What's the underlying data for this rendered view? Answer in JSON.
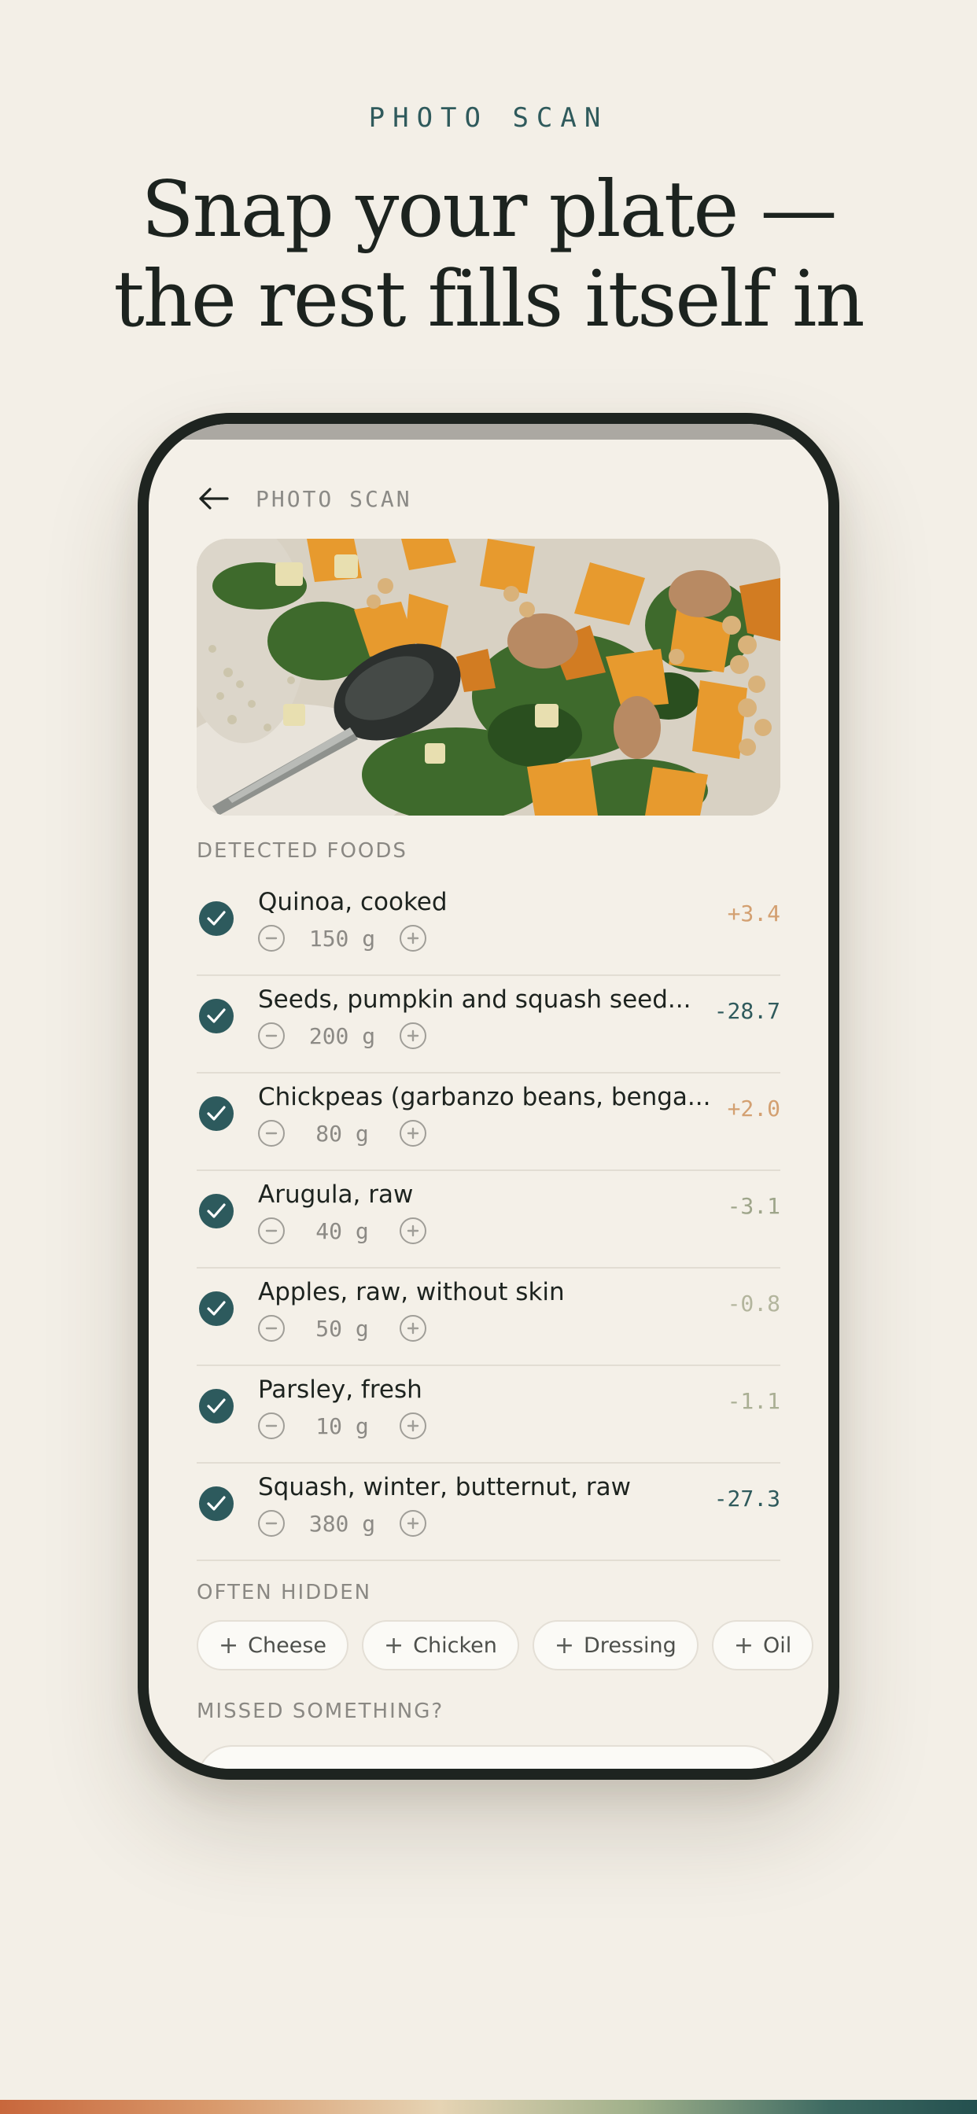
{
  "header": {
    "eyebrow": "PHOTO SCAN",
    "headline_line1": "Snap your plate —",
    "headline_line2": "the rest fills itself in"
  },
  "screen": {
    "topbar_title": "PHOTO SCAN",
    "back_icon": "arrow-left-icon",
    "detected_label": "DETECTED FOODS",
    "foods": [
      {
        "name": "Quinoa, cooked",
        "qty": "150 g",
        "delta": "+3.4",
        "delta_color": "#d3a071"
      },
      {
        "name": "Seeds, pumpkin and squash seed...",
        "qty": "200 g",
        "delta": "-28.7",
        "delta_color": "#2f5a5c"
      },
      {
        "name": "Chickpeas (garbanzo beans, benga...",
        "qty": "80 g",
        "delta": "+2.0",
        "delta_color": "#d3a071"
      },
      {
        "name": "Arugula, raw",
        "qty": "40 g",
        "delta": "-3.1",
        "delta_color": "#9ea58a"
      },
      {
        "name": "Apples, raw, without skin",
        "qty": "50 g",
        "delta": "-0.8",
        "delta_color": "#b3b59d"
      },
      {
        "name": "Parsley, fresh",
        "qty": "10 g",
        "delta": "-1.1",
        "delta_color": "#aaaf94"
      },
      {
        "name": "Squash, winter, butternut, raw",
        "qty": "380 g",
        "delta": "-27.3",
        "delta_color": "#2f5a5c"
      }
    ],
    "hidden_label": "OFTEN HIDDEN",
    "hidden_chips": [
      "Cheese",
      "Chicken",
      "Dressing",
      "Oil"
    ],
    "missed_label": "MISSED SOMETHING?"
  },
  "colors": {
    "accent": "#2d5a5d",
    "background": "#f3efe7",
    "phone_frame": "#1e2420"
  }
}
